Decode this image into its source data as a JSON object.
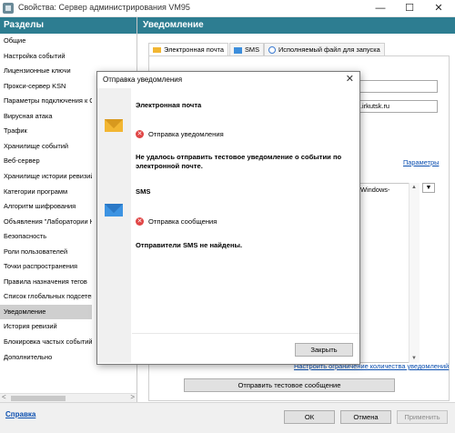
{
  "window": {
    "title": "Свойства: Сервер администрирования VM95",
    "minimize": "—",
    "maximize": "☐",
    "close": "✕"
  },
  "sidebar": {
    "header": "Разделы",
    "items": [
      "Общие",
      "Настройка событий",
      "Лицензионные ключи",
      "Прокси-сервер KSN",
      "Параметры подключения к С",
      "Вирусная атака",
      "Трафик",
      "Хранилище событий",
      "Веб-сервер",
      "Хранилище истории ревизий",
      "Категории программ",
      "Алгоритм шифрования",
      "Объявления \"Лаборатории Ка",
      "Безопасность",
      "Роли пользователей",
      "Точки распространения",
      "Правила назначения тегов",
      "Список глобальных подсетей",
      "Уведомление",
      "История ревизий",
      "Блокировка частых событий",
      "Дополнительно"
    ],
    "selected_index": 18
  },
  "panel": {
    "title": "Уведомление",
    "tabs": [
      "Электронная почта",
      "SMS",
      "Исполняемый файл для запуска"
    ],
    "field_smtp_value": ".irkutsk.ru",
    "params_link": "Параметры",
    "message_preview": "Windows-",
    "limit_link": "Настроить ограничение количества уведомлений",
    "send_test_button": "Отправить тестовое сообщение"
  },
  "footer": {
    "help": "Справка",
    "ok": "ОК",
    "cancel": "Отмена",
    "apply": "Применить"
  },
  "dialog": {
    "title": "Отправка уведомления",
    "close": "✕",
    "email_header": "Электронная почта",
    "email_status": "Отправка уведомления",
    "email_error": "Не удалось отправить тестовое уведомление о событии по электронной почте.",
    "sms_header": "SMS",
    "sms_status": "Отправка сообщения",
    "sms_error": "Отправители SMS не найдены.",
    "close_button": "Закрыть"
  },
  "colors": {
    "header_bg": "#2d7d91",
    "link": "#0b4fb0",
    "error": "#e04545",
    "email_icon": "#f2b632",
    "sms_icon": "#3c93e2"
  }
}
